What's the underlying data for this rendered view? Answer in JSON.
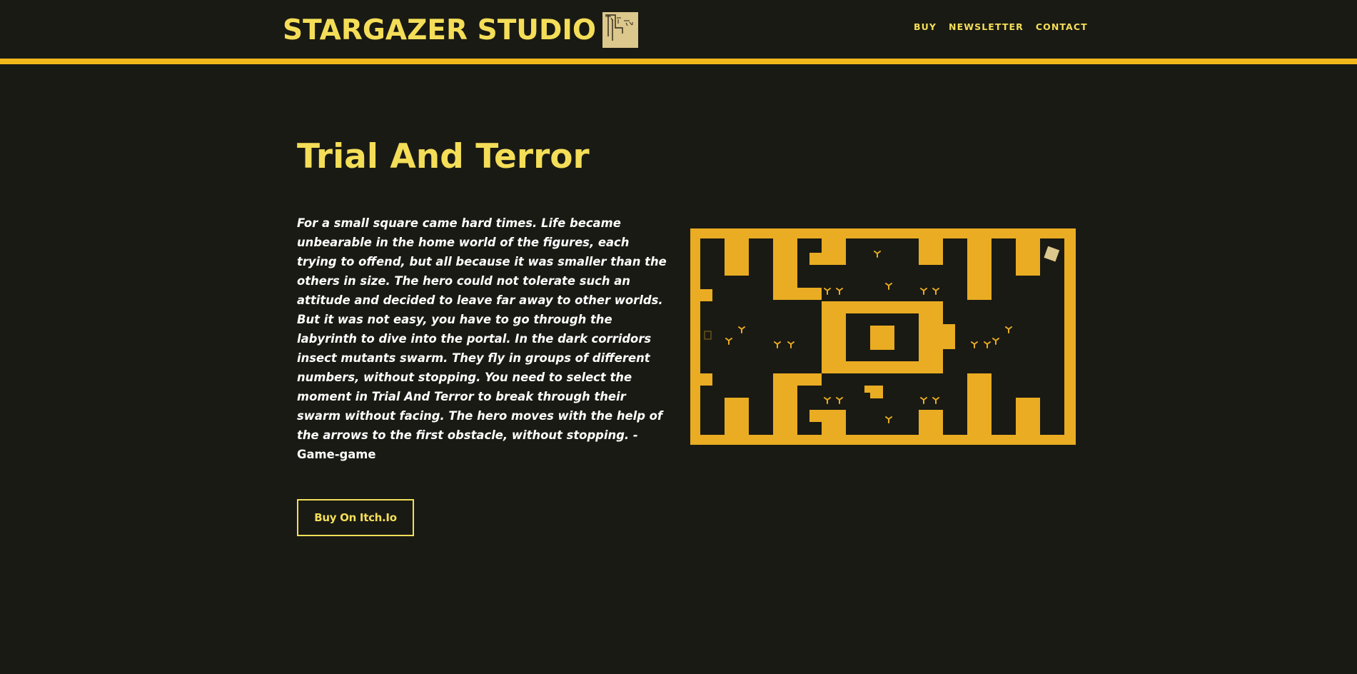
{
  "site": {
    "brand_title": "STARGAZER STUDIO",
    "brand_logo_icon": "trial-and-terror-logo"
  },
  "nav": {
    "items": [
      "BUY",
      "NEWSLETTER",
      "CONTACT"
    ]
  },
  "game": {
    "title": "Trial And Terror",
    "description": "For a small square came hard times. Life became unbearable in the home world of the figures, each trying to offend, but all because it was smaller than the others in size. The hero could not tolerate such an attitude and decided to leave far away to other worlds. But it was not easy, you have to go through the labyrinth to dive into the portal. In the dark corridors insect mutants swarm. They fly in groups of different numbers, without stopping. You need to select the moment in Trial And Terror to break through their swarm without facing. The hero moves with the help of the arrows to the first obstacle, without stopping. -",
    "description_source": "Game-game",
    "buy_label": "Buy On Itch.Io",
    "screenshot_icon": "game-maze-screenshot"
  },
  "colors": {
    "background": "#1a1a14",
    "accent_yellow": "#f4de58",
    "accent_bar": "#f2b81b",
    "maze_gold": "#e9ac22",
    "logo_tan": "#dcc78c",
    "text_white": "#ffffff"
  }
}
